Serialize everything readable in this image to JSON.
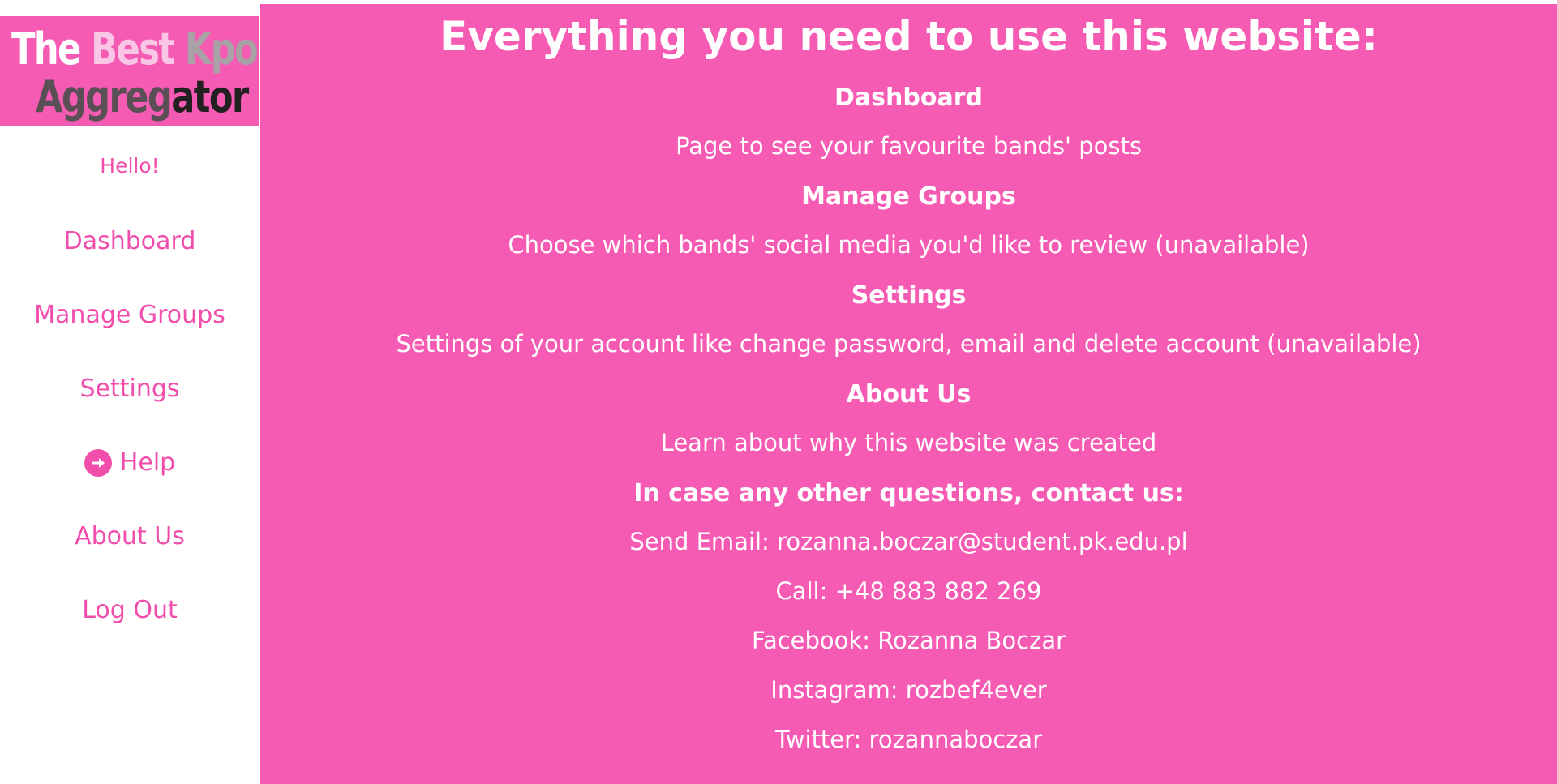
{
  "logo": {
    "line1": [
      "The",
      "Best",
      "Kpop"
    ],
    "line2": [
      "Aggreg",
      "ator"
    ]
  },
  "sidebar": {
    "greeting": "Hello!",
    "items": [
      {
        "label": "Dashboard"
      },
      {
        "label": "Manage Groups"
      },
      {
        "label": "Settings"
      },
      {
        "label": "Help",
        "icon": "arrow-right-circle-icon"
      },
      {
        "label": "About Us"
      },
      {
        "label": "Log Out"
      }
    ]
  },
  "main": {
    "title": "Everything you need to use this website:",
    "sections": [
      {
        "heading": "Dashboard",
        "text": "Page to see your favourite bands' posts"
      },
      {
        "heading": "Manage Groups",
        "text": "Choose which bands' social media you'd like to review (unavailable)"
      },
      {
        "heading": "Settings",
        "text": "Settings of your account like change password, email and delete account (unavailable)"
      },
      {
        "heading": "About Us",
        "text": "Learn about why this website was created"
      }
    ],
    "contact": {
      "heading": "In case any other questions, contact us:",
      "email": "Send Email: rozanna.boczar@student.pk.edu.pl",
      "phone": "Call: +48 883 882 269",
      "facebook": "Facebook: Rozanna Boczar",
      "instagram": "Instagram: rozbef4ever",
      "twitter": "Twitter: rozannaboczar"
    }
  },
  "colors": {
    "primary_pink": "#f65bb4",
    "nav_pink": "#f14eac",
    "text_on_pink": "#ffffff"
  }
}
